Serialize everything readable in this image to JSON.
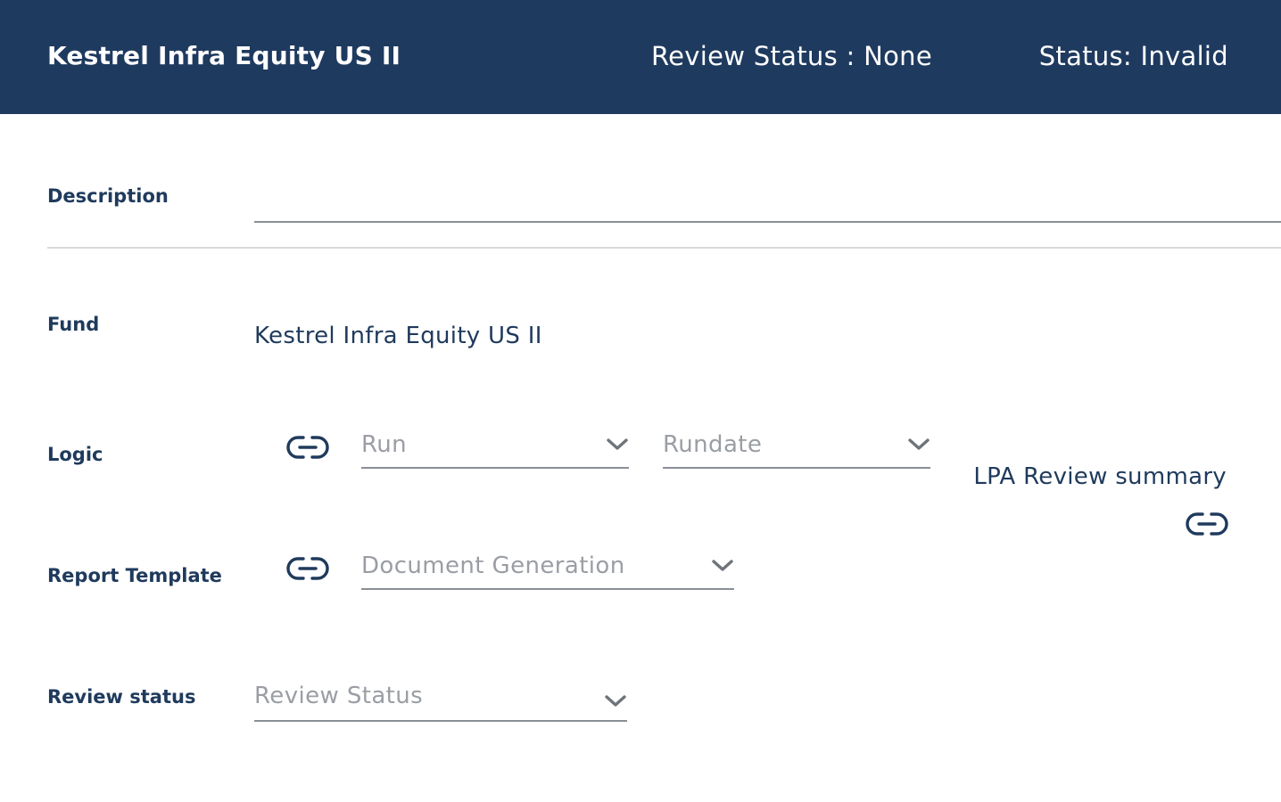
{
  "header": {
    "title": "Kestrel Infra Equity US II",
    "review_status": "Review Status : None",
    "status": "Status: Invalid"
  },
  "form": {
    "description": {
      "label": "Description",
      "value": ""
    },
    "fund": {
      "label": "Fund",
      "value": "Kestrel Infra Equity US II"
    },
    "logic": {
      "label": "Logic",
      "run_placeholder": "Run",
      "rundate_placeholder": "Rundate"
    },
    "report_template": {
      "label": "Report Template",
      "placeholder": "Document Generation"
    },
    "review_status": {
      "label": "Review status",
      "placeholder": "Review Status"
    },
    "lpa_review_summary": {
      "label": "LPA Review summary"
    }
  },
  "icons": {
    "link": "link-icon",
    "chevron": "chevron-down-icon"
  },
  "colors": {
    "header_bg": "#1f3a5f",
    "text": "#1f3a5c",
    "placeholder": "#9a9ea4",
    "underline": "#8a8f96"
  }
}
